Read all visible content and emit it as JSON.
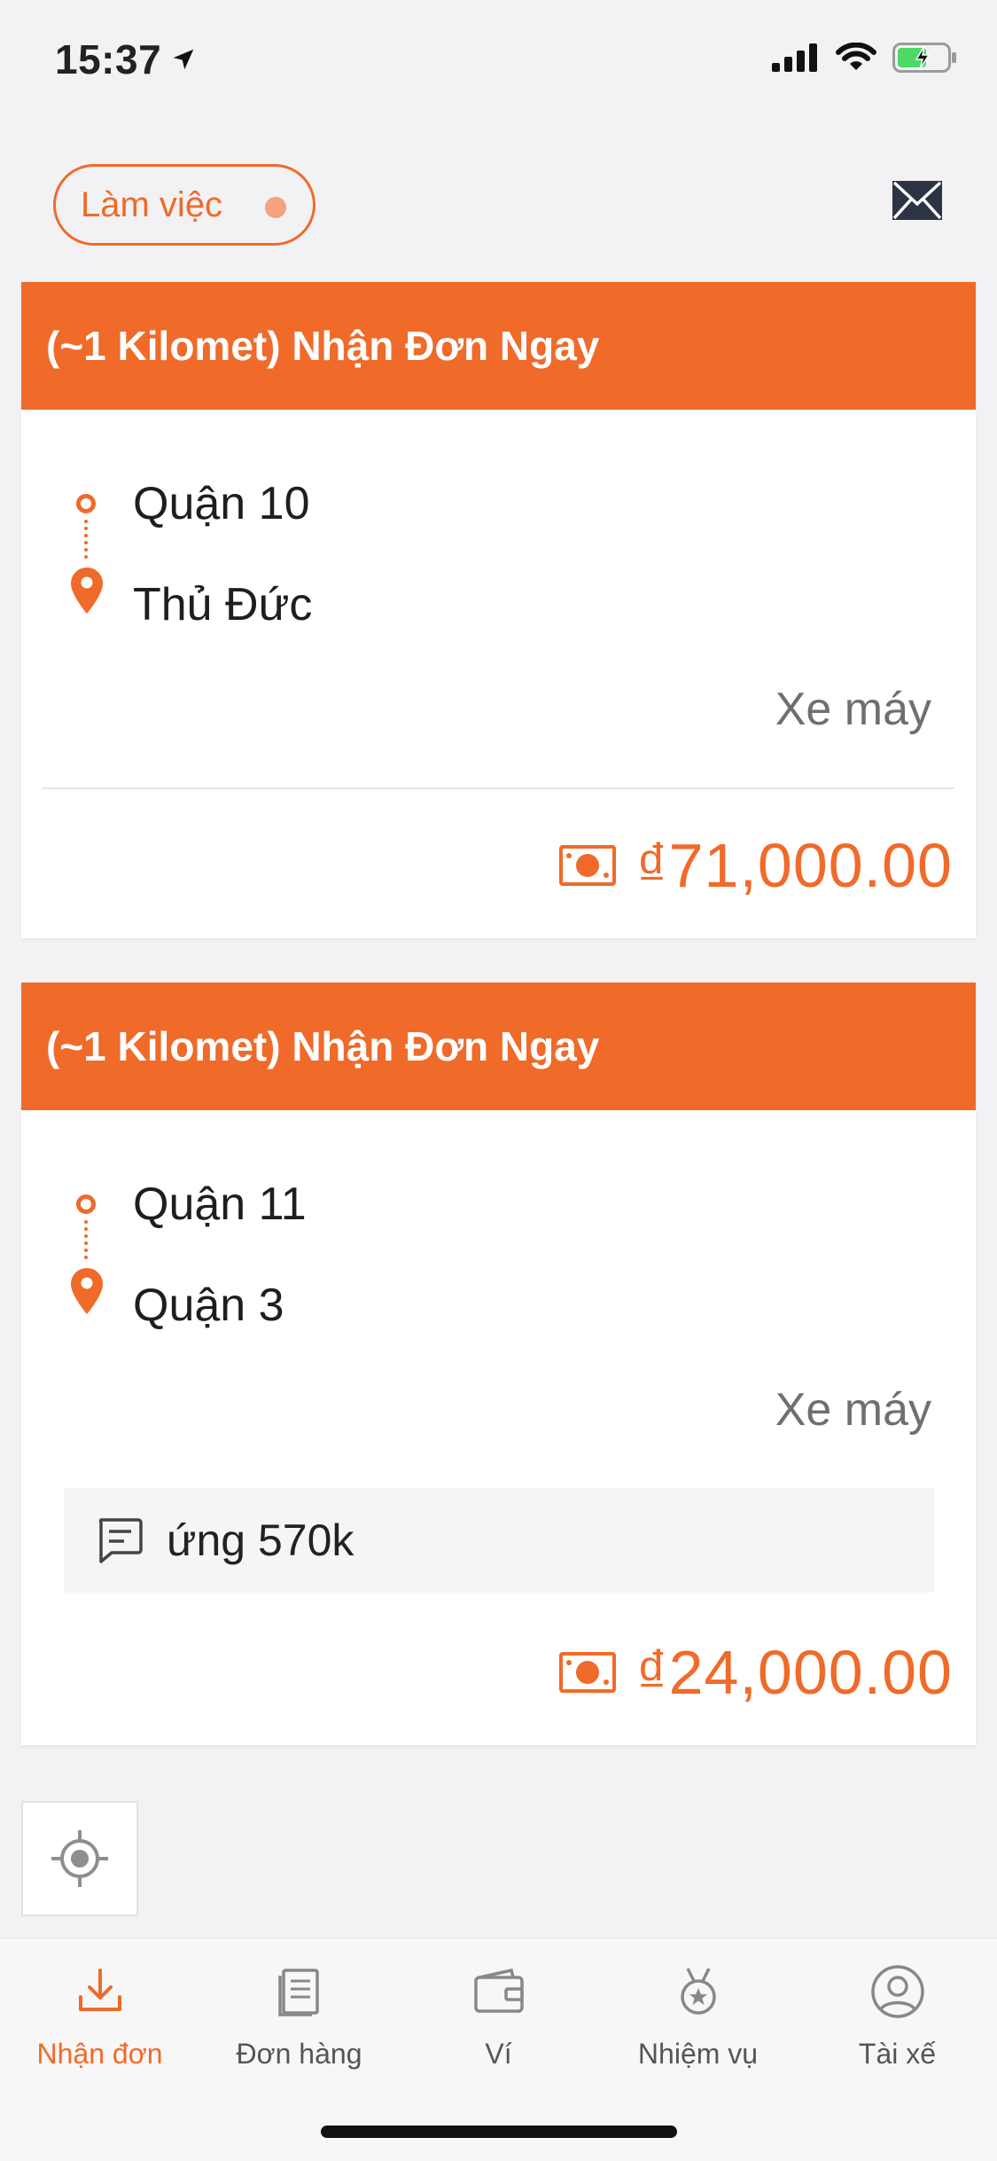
{
  "status_bar": {
    "time": "15:37",
    "battery_state": "charging"
  },
  "top_bar": {
    "work_toggle_label": "Làm việc"
  },
  "orders": [
    {
      "header": "(~1 Kilomet) Nhận Đơn Ngay",
      "from": "Quận 10",
      "to": "Thủ Đức",
      "vehicle": "Xe máy",
      "note": "",
      "price": "₫71,000.00"
    },
    {
      "header": "(~1 Kilomet) Nhận Đơn Ngay",
      "from": "Quận 11",
      "to": "Quận 3",
      "vehicle": "Xe máy",
      "note": "ứng 570k",
      "price": "₫24,000.00"
    }
  ],
  "tabs": [
    {
      "label": "Nhận đơn",
      "icon": "download-icon",
      "active": true
    },
    {
      "label": "Đơn hàng",
      "icon": "document-icon",
      "active": false
    },
    {
      "label": "Ví",
      "icon": "wallet-icon",
      "active": false
    },
    {
      "label": "Nhiệm vụ",
      "icon": "medal-icon",
      "active": false
    },
    {
      "label": "Tài xế",
      "icon": "user-icon",
      "active": false
    }
  ],
  "colors": {
    "accent": "#f06a29",
    "background": "#f2f2f4",
    "card": "#ffffff"
  }
}
